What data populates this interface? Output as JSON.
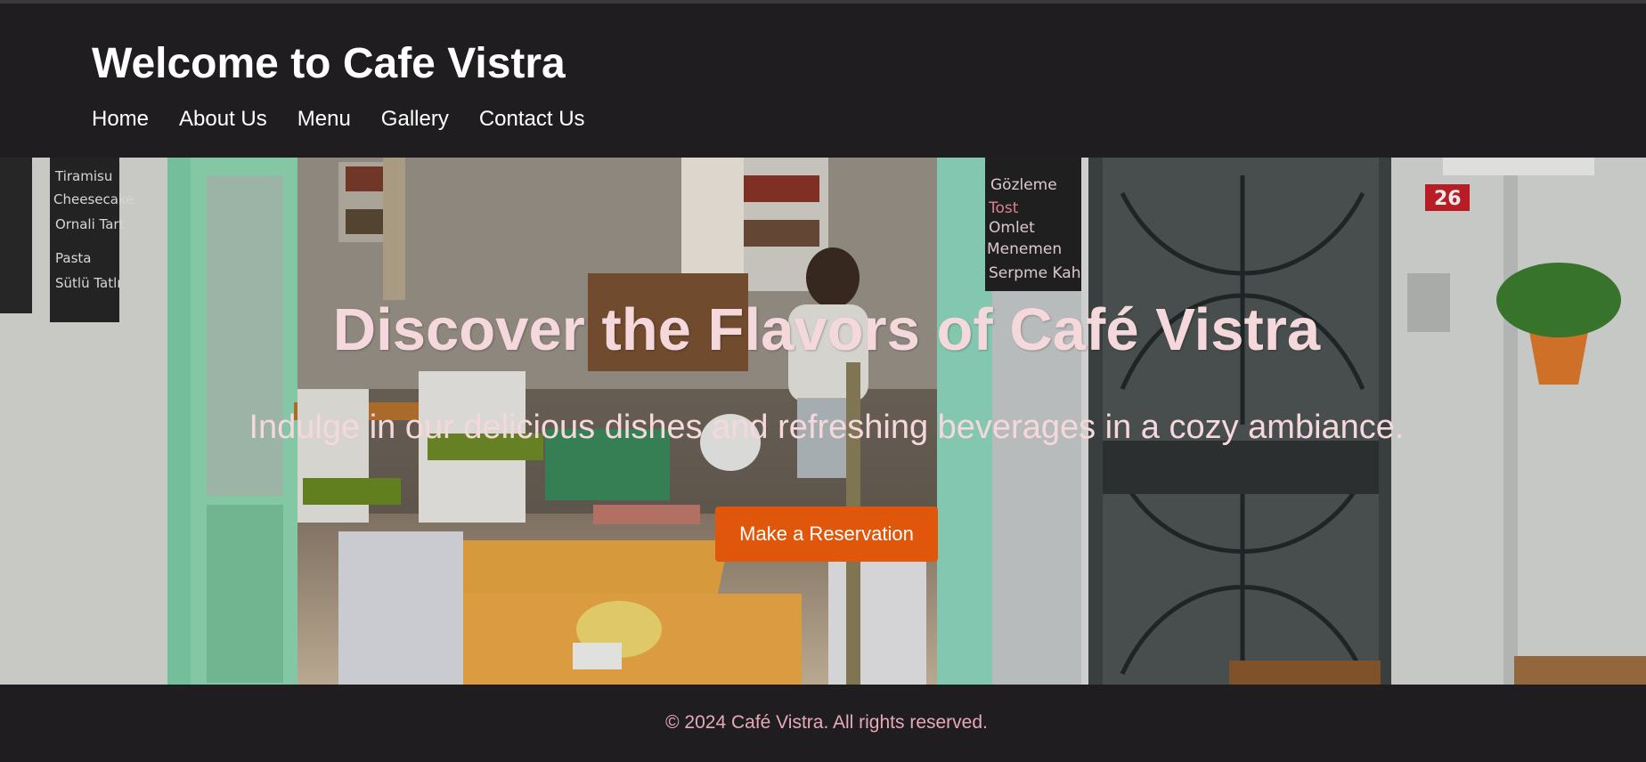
{
  "header": {
    "title": "Welcome to Cafe Vistra",
    "nav": [
      "Home",
      "About Us",
      "Menu",
      "Gallery",
      "Contact Us"
    ]
  },
  "hero": {
    "heading": "Discover the Flavors of Café Vistra",
    "subheading": "Indulge in our delicious dishes and refreshing beverages in a cozy ambiance.",
    "cta_label": "Make a Reservation",
    "image_text": {
      "chalkboard_left": [
        "Tiramisu",
        "Cheesecake",
        "Ornali Tart",
        "Pasta",
        "Sütlü Tatlı"
      ],
      "chalkboard_right": [
        "Gözleme",
        "Tost",
        "Omlet",
        "Menemen",
        "Serpme Kahvaltı"
      ],
      "door_number": "26"
    }
  },
  "footer": {
    "copyright": "© 2024 Café Vistra. All rights reserved."
  },
  "colors": {
    "background": "#1f1d1f",
    "accent": "#e0560a",
    "hero_text": "#f5d8dc",
    "footer_text": "#e6aab6"
  }
}
